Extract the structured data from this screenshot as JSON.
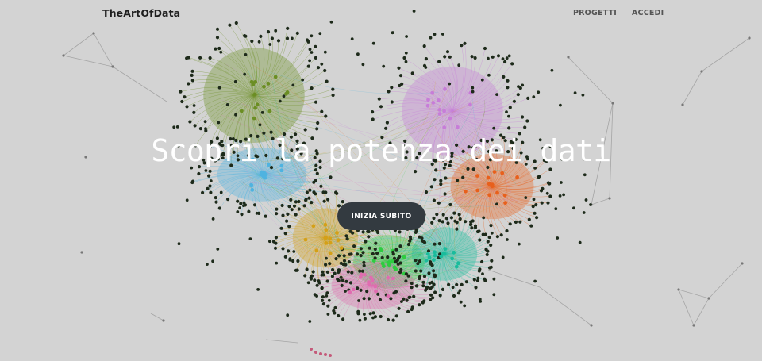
{
  "header": {
    "brand": "TheArtOfData",
    "nav": [
      {
        "label": "PROGETTI"
      },
      {
        "label": "ACCEDI"
      }
    ]
  },
  "hero": {
    "title": "Scopri la potenza dei dati",
    "cta_label": "INIZIA SUBITO"
  },
  "theme": {
    "background": "#d3d3d3",
    "title_color": "#ffffff",
    "button_color": "#333a40",
    "node_dark": "#1d2a1a",
    "cluster_colors": [
      "#6b8e23",
      "#4fb3e0",
      "#c77dd8",
      "#e8601c",
      "#2ecc40",
      "#e06cb0",
      "#1abc9c",
      "#d4a017"
    ]
  }
}
